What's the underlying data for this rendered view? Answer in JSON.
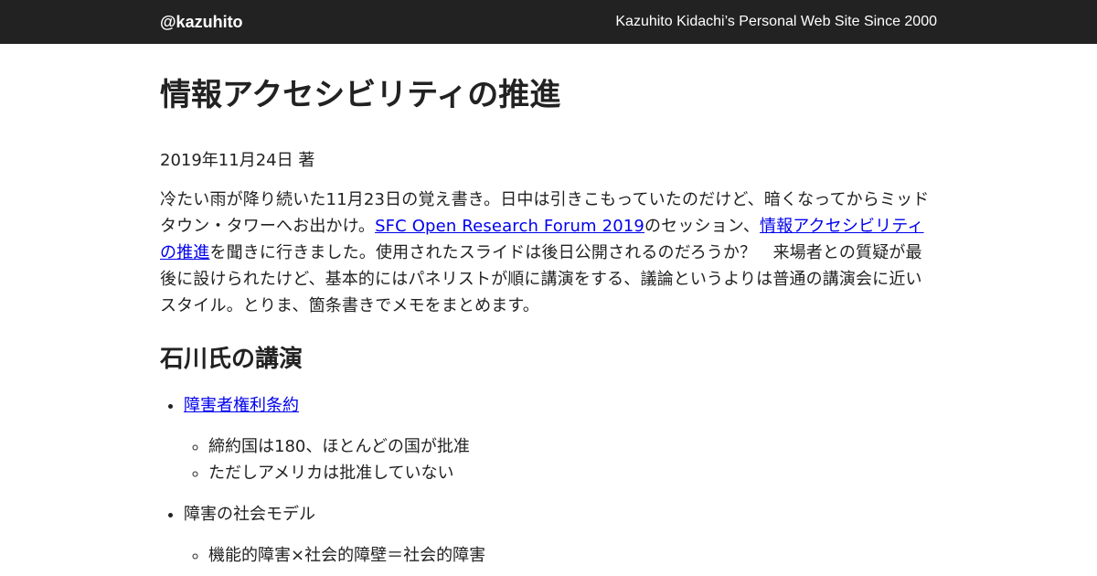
{
  "header": {
    "site_title": "@kazuhito",
    "site_description": "Kazuhito Kidachi’s Personal Web Site Since 2000"
  },
  "article": {
    "title": "情報アクセシビリティの推進",
    "date": "2019年11月24日 著",
    "lead": {
      "part1": "冷たい雨が降り続いた11月23日の覚え書き。日中は引きこもっていたのだけど、暗くなってからミッドタウン・タワーへお出かけ。",
      "link1": "SFC Open Research Forum 2019",
      "part2": "のセッション、",
      "link2": "情報アクセシビリティの推進",
      "part3": "を聞きに行きました。使用されたスライドは後日公開されるのだろうか？　来場者との質疑が最後に設けられたけど、基本的にはパネリストが順に講演をする、議論というよりは普通の講演会に近いスタイル。とりま、箇条書きでメモをまとめます。"
    },
    "section1": {
      "heading": "石川氏の講演",
      "items": [
        {
          "label": "障害者権利条約",
          "is_link": true,
          "subitems": [
            "締約国は180、ほとんどの国が批准",
            "ただしアメリカは批准していない"
          ]
        },
        {
          "label": "障害の社会モデル",
          "is_link": false,
          "subitems": [
            "機能的障害×社会的障壁＝社会的障害"
          ]
        }
      ]
    }
  }
}
